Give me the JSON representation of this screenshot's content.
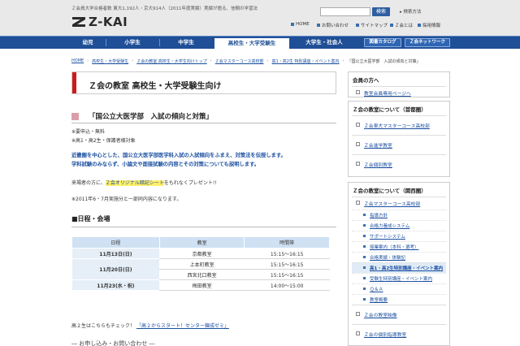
{
  "header": {
    "tagline": "Ｚ会員大学合格者数 東大1,192人・京大914人（2011年度実績）実績が語る、信頼の学習法",
    "logo_text": "Z-KAI",
    "search_button": "検索",
    "search_method": "検索方法",
    "utility_links": [
      "HOME",
      "お問い合わせ",
      "サイトマップ",
      "Ｚ会とは",
      "採用情報"
    ]
  },
  "nav": {
    "tabs": [
      "幼児",
      "小学生",
      "中学生",
      "高校生・大学受験生",
      "大学生・社会人"
    ],
    "active_tab": "高校生・大学受験生",
    "buttons": [
      "図書カタログ",
      "Ｚ会ネットワーク"
    ]
  },
  "breadcrumb": [
    "HOME",
    "高校生・大学受験生",
    "Ｚ会の教室 高校生・大学生向けトップ",
    "Ｚ会マスターコース高校部",
    "高1・高2生 特別講座・イベント案内",
    "「国公立大医学部　入試の傾向と対策」"
  ],
  "main": {
    "page_title": "Ｚ会の教室 高校生・大学受験生向け",
    "event_title": "「国公立大医学部　入試の傾向と対策」",
    "note_1": "※要申込・無料",
    "note_2": "※高1・高2生・保護者様対象",
    "desc_1": "近畿圏を中心とした、国公立大医学部医学科入試の入試傾向をふまえ、対策法を伝授します。",
    "desc_2": "学科試験のみならず、小論文や面接試験の内容とその対策についても説明します。",
    "gift_before": "来場者の方に、",
    "gift_highlight": "Ｚ会オリジナル暗記シート",
    "gift_after": "をもれなくプレゼント!!",
    "repeat_note": "※2011年6・7月実施分と一部同内容になります。",
    "schedule_heading": "■日程・会場",
    "table_headers": [
      "日程",
      "教室",
      "時間帯"
    ],
    "table_rows": [
      {
        "date": "11月13日(日)",
        "room": "京都教室",
        "time": "15:15～16:15"
      },
      {
        "date": "11月20日(日)",
        "room": "上本町教室",
        "time": "15:15～16:15"
      },
      {
        "date": "",
        "room": "西宮北口教室",
        "time": "15:15～16:15"
      },
      {
        "date": "11月23(水・祝)",
        "room": "梅田教室",
        "time": "14:00～15:00"
      }
    ],
    "footer_prefix": "高２生はこちらもチェック！",
    "footer_link": "「高２からスタート！センター錬成ゼミ」",
    "next_heading": "― お申し込み・お問い合わせ ―"
  },
  "sidebar": {
    "members_heading": "会員の方へ",
    "members_link": "教室会員専用ページへ",
    "tokyo_heading": "Ｚ会の教室について（首都圏）",
    "tokyo_items": [
      "Ｚ会東大マスターコース高校部",
      "Ｚ会進学教室",
      "Ｚ会個別教室"
    ],
    "kansai_heading": "Ｚ会の教室について（関西圏）",
    "kansai_main": "Ｚ会マスターコース高校部",
    "kansai_sub": [
      "指導方針",
      "合格力養成システム",
      "サポートシステム",
      "授業案内（本科・選考）",
      "合格実績・体験記",
      "高1・高2生特別講座・イベント案内",
      "受験生特別講座・イベント案内",
      "Ｑ＆Ａ",
      "教室概要"
    ],
    "kansai_current": "高1・高2生特別講座・イベント案内",
    "kansai_bottom": [
      "Ｚ会の教室映像",
      "Ｚ会の個別指導教室"
    ]
  }
}
